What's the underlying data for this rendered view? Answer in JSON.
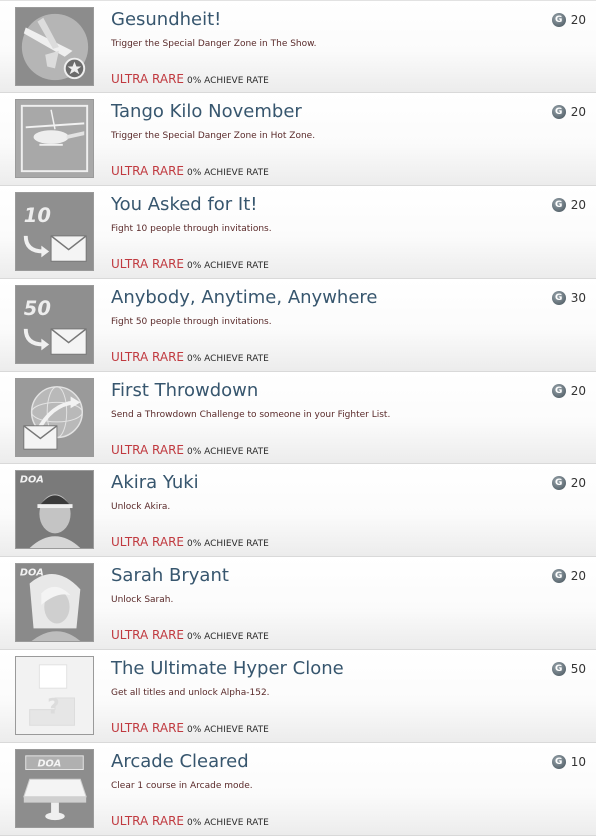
{
  "colors": {
    "title": "#37566e",
    "description": "#5a2a2a",
    "rarity": "#c0393f",
    "rate": "#2b2b2b",
    "gamerscore_icon": "#5d6a72"
  },
  "gamerscore_icon_letter": "G",
  "achievements": [
    {
      "title": "Gesundheit!",
      "description": "Trigger the Special Danger Zone in The Show.",
      "rarity": "ULTRA RARE",
      "rate": "0% ACHIEVE RATE",
      "points": "20",
      "icon": "jet-fighter-icon"
    },
    {
      "title": "Tango Kilo November",
      "description": "Trigger the Special Danger Zone in Hot Zone.",
      "rarity": "ULTRA RARE",
      "rate": "0% ACHIEVE RATE",
      "points": "20",
      "icon": "helicopter-icon"
    },
    {
      "title": "You Asked for It!",
      "description": "Fight 10 people through invitations.",
      "rarity": "ULTRA RARE",
      "rate": "0% ACHIEVE RATE",
      "points": "20",
      "icon": "invitation-10-icon",
      "badge": "10"
    },
    {
      "title": "Anybody, Anytime, Anywhere",
      "description": "Fight 50 people through invitations.",
      "rarity": "ULTRA RARE",
      "rate": "0% ACHIEVE RATE",
      "points": "30",
      "icon": "invitation-50-icon",
      "badge": "50"
    },
    {
      "title": "First Throwdown",
      "description": "Send a Throwdown Challenge to someone in your Fighter List.",
      "rarity": "ULTRA RARE",
      "rate": "0% ACHIEVE RATE",
      "points": "20",
      "icon": "globe-envelope-icon"
    },
    {
      "title": "Akira Yuki",
      "description": "Unlock Akira.",
      "rarity": "ULTRA RARE",
      "rate": "0% ACHIEVE RATE",
      "points": "20",
      "icon": "akira-portrait-icon",
      "badge": "DOA"
    },
    {
      "title": "Sarah Bryant",
      "description": "Unlock Sarah.",
      "rarity": "ULTRA RARE",
      "rate": "0% ACHIEVE RATE",
      "points": "20",
      "icon": "sarah-portrait-icon",
      "badge": "DOA"
    },
    {
      "title": "The Ultimate Hyper Clone",
      "description": "Get all titles and unlock Alpha-152.",
      "rarity": "ULTRA RARE",
      "rate": "0% ACHIEVE RATE",
      "points": "50",
      "icon": "secret-question-icon",
      "badge": "?"
    },
    {
      "title": "Arcade Cleared",
      "description": "Clear 1 course in Arcade mode.",
      "rarity": "ULTRA RARE",
      "rate": "0% ACHIEVE RATE",
      "points": "10",
      "icon": "arcade-trophy-icon",
      "badge": "DOA"
    }
  ]
}
